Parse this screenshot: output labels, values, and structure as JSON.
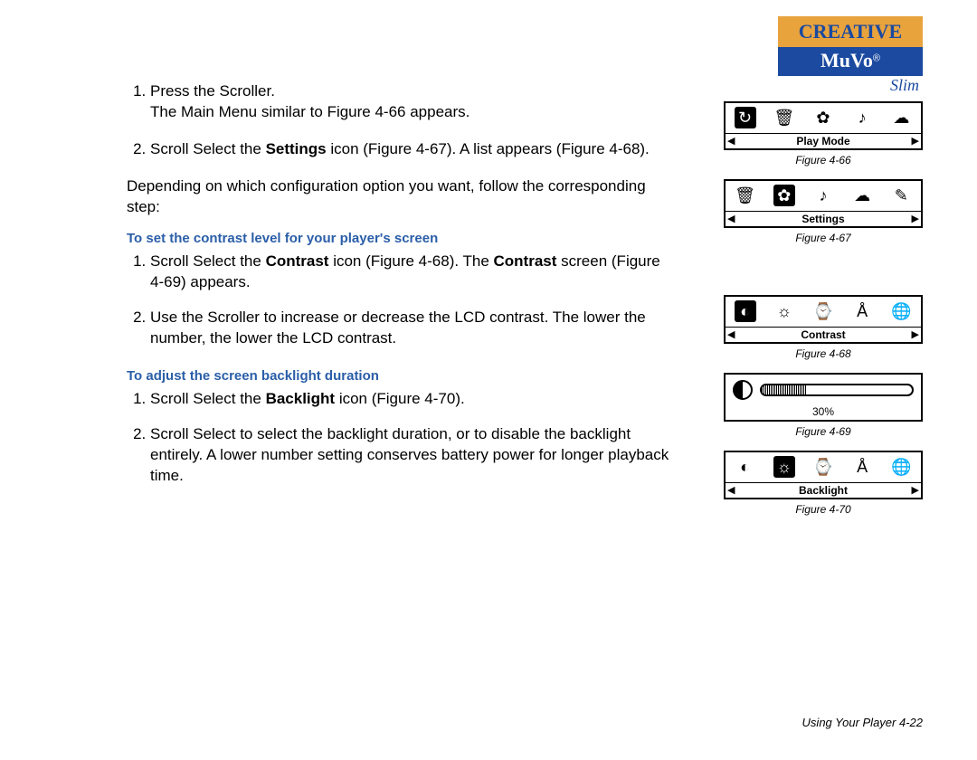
{
  "brand": {
    "creative": "CREATIVE",
    "muvo": "MuVo",
    "slim": "Slim"
  },
  "intro_steps": [
    {
      "num": "1.",
      "text_a": "Press the Scroller.",
      "text_b": "The Main Menu similar to Figure 4-66 appears."
    },
    {
      "num": "2.",
      "text_a_pre": "Scroll Select the ",
      "text_a_bold": "Settings",
      "text_a_post": " icon (Figure 4-67). A list appears (Figure 4-68)."
    }
  ],
  "depending": "Depending on which configuration option you want, follow the corresponding step:",
  "section1": {
    "title": "To set the contrast level for your player's screen",
    "steps": [
      {
        "pre": "Scroll Select the ",
        "b": "Contrast",
        "mid": " icon (Figure 4-68). The ",
        "b2": "Contrast",
        "post": " screen (Figure 4-69) appears."
      },
      {
        "text": "Use the Scroller to increase or decrease the LCD contrast. The lower the number, the lower the LCD contrast."
      }
    ]
  },
  "section2": {
    "title": "To adjust the screen backlight duration",
    "steps": [
      {
        "pre": "Scroll Select the ",
        "b": "Backlight",
        "post": " icon (Figure 4-70)."
      },
      {
        "text": "Scroll Select to select the backlight duration, or to disable the backlight entirely. A lower number setting conserves battery power for longer playback time."
      }
    ]
  },
  "figures": {
    "f66": {
      "label": "Play Mode",
      "cap": "Figure 4-66",
      "sel": 0
    },
    "f67": {
      "label": "Settings",
      "cap": "Figure 4-67",
      "sel": 1
    },
    "f68": {
      "label": "Contrast",
      "cap": "Figure 4-68",
      "sel": 0
    },
    "f69": {
      "val": "30%",
      "cap": "Figure 4-69"
    },
    "f70": {
      "label": "Backlight",
      "cap": "Figure 4-70",
      "sel": 1
    }
  },
  "footer": "Using Your Player 4-22"
}
